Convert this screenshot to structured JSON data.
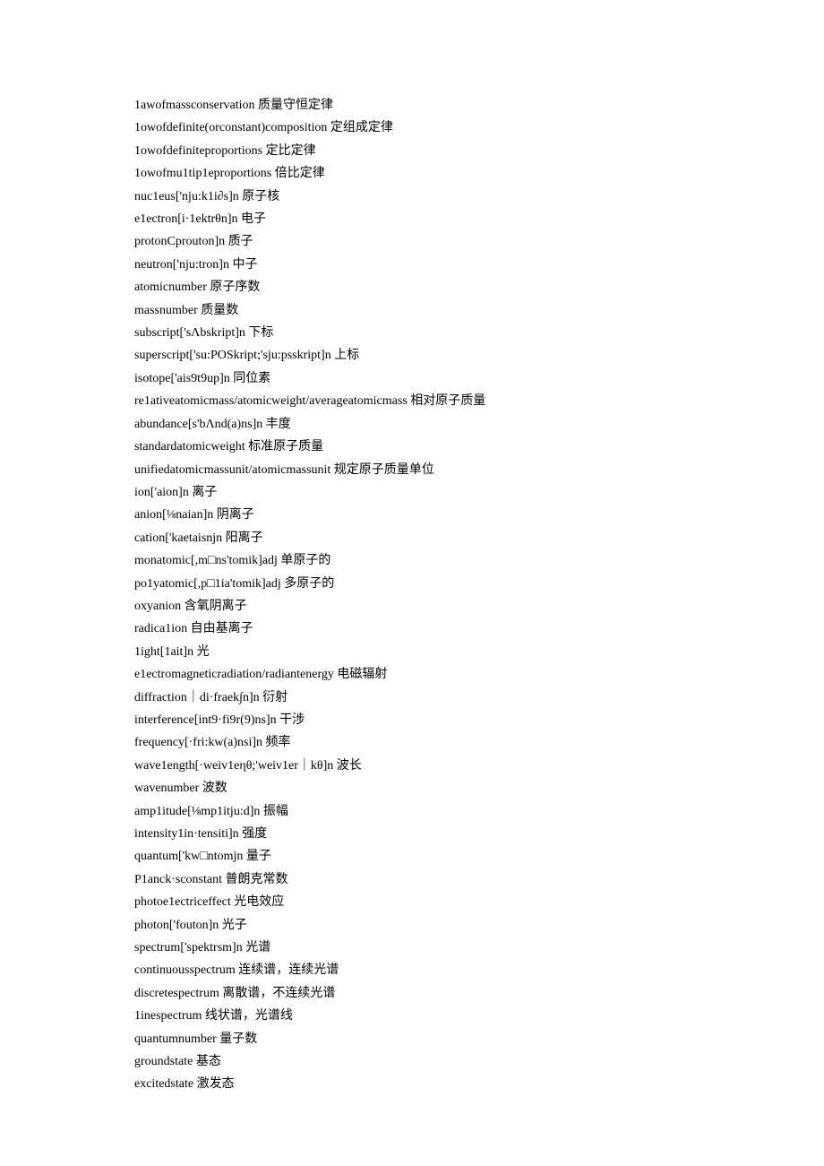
{
  "entries": [
    "1awofmassconservation 质量守恒定律",
    "1owofdefinite(orconstant)composition 定组成定律",
    "1owofdefiniteproportions 定比定律",
    "1owofmu1tip1eproportions 倍比定律",
    "nuc1eus['nju:k1i∂s]n 原子核",
    "e1ectron[i·1ektrθn]n 电子",
    "protonCprouton]n 质子",
    "neutron['nju:tron]n 中子",
    "atomicnumber 原子序数",
    "massnumber 质量数",
    "subscript['sΛbskript]n 下标",
    "superscript['su:POSkript;'sju:psskript]n 上标",
    "isotope['ais9t9up]n 同位素",
    "re1ativeatomicmass/atomicweight/averageatomicmass 相对原子质量",
    "abundance[s'bΛnd(a)ns]n 丰度",
    "standardatomicweight 标准原子质量",
    "unifiedatomicmassunit/atomicmassunit 规定原子质量单位",
    "ion['aion]n 离子",
    "anion[⅛naian]n 阴离子",
    "cation['kaetaisnjn 阳离子",
    "monatomic[,m□ns'tomik]adj 单原子的",
    "po1yatomic[,p□1ia'tomik]adj 多原子的",
    "oxyanion 含氧阴离子",
    "radica1ion 自由基离子",
    "1ight[1ait]n 光",
    "e1ectromagneticradiation/radiantenergy 电磁辐射",
    "diffraction｜di·fraek∫n]n 衍射",
    "interference[int9·fi9r(9)ns]n 干涉",
    "frequency[·fri:kw(a)nsi]n 频率",
    "wave1ength[·weiv1eηθ;'weiv1er｜kθ]n 波长",
    "wavenumber 波数",
    "amp1itude[⅛mp1itju:d]n 振幅",
    "intensity1in·tensiti]n 强度",
    "quantum['kw□ntomjn 量子",
    "P1anck·sconstant 普朗克常数",
    "photoe1ectriceffect 光电效应",
    "photon['fouton]n 光子",
    "spectrum['spektrsm]n 光谱",
    "continuousspectrum 连续谱，连续光谱",
    "discretespectrum 离散谱，不连续光谱",
    "1inespectrum 线状谱，光谱线",
    "quantumnumber 量子数",
    "groundstate 基态",
    "excitedstate 激发态"
  ]
}
